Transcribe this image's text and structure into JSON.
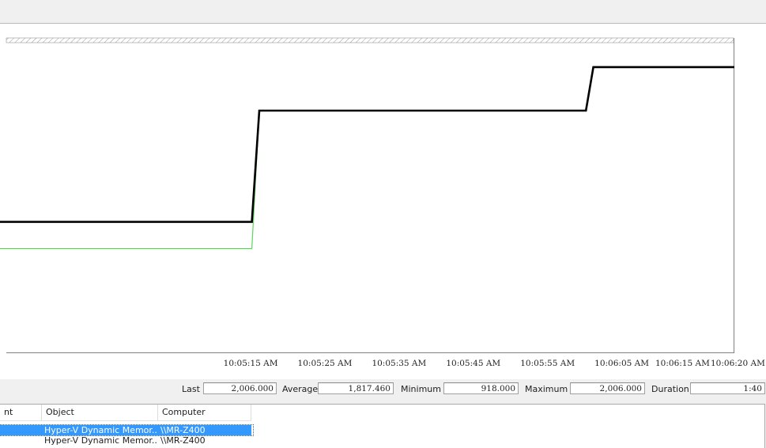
{
  "chart_data": {
    "type": "line",
    "xlabel": "",
    "ylabel": "",
    "x_ticks": [
      "10:05:15 AM",
      "10:05:25 AM",
      "10:05:35 AM",
      "10:05:45 AM",
      "10:05:55 AM",
      "10:06:05 AM",
      "10:06:15 AM",
      "10:06:20 AM"
    ],
    "x_range": [
      "10:04:40 AM",
      "10:06:20 AM"
    ],
    "ylim": [
      0,
      2200
    ],
    "grid": false,
    "series": [
      {
        "color": "#000000",
        "points": [
          {
            "t": 0,
            "v": 918
          },
          {
            "t": 35,
            "v": 918
          },
          {
            "t": 36,
            "v": 1700
          },
          {
            "t": 80,
            "v": 1700
          },
          {
            "t": 81,
            "v": 2006
          },
          {
            "t": 100,
            "v": 2006
          }
        ]
      },
      {
        "color": "#5cd65c",
        "points": [
          {
            "t": 0,
            "v": 730
          },
          {
            "t": 35,
            "v": 730
          },
          {
            "t": 36,
            "v": 1700
          }
        ]
      }
    ]
  },
  "stats": {
    "last_label": "Last",
    "last_value": "2,006.000",
    "average_label": "Average",
    "average_value": "1,817.460",
    "minimum_label": "Minimum",
    "minimum_value": "918.000",
    "maximum_label": "Maximum",
    "maximum_value": "2,006.000",
    "duration_label": "Duration",
    "duration_value": "1:40"
  },
  "legend": {
    "columns": {
      "counter": "nt",
      "object": "Object",
      "computer": "Computer"
    },
    "rows": [
      {
        "object": "Hyper-V Dynamic Memor...",
        "computer": "\\\\MR-Z400",
        "selected": true
      },
      {
        "object": "Hyper-V Dynamic Memor...",
        "computer": "\\\\MR-Z400",
        "selected": false
      }
    ]
  }
}
